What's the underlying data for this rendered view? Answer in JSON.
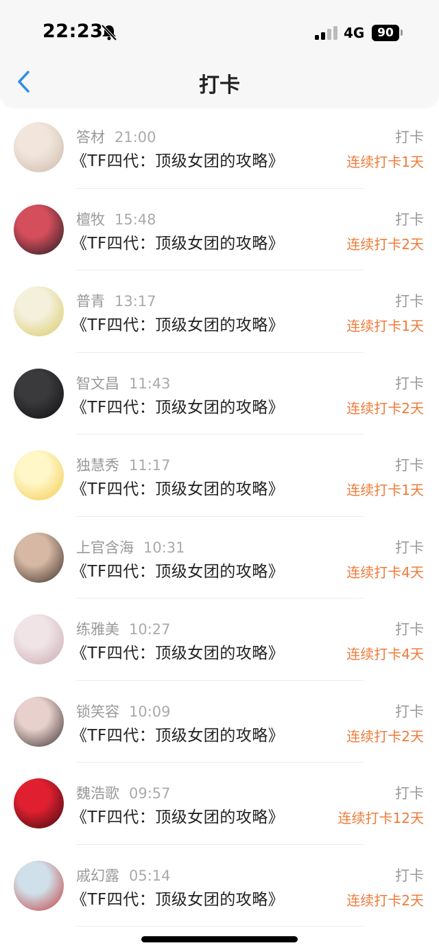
{
  "status_bar": {
    "time": "22:23",
    "network": "4G",
    "battery": "90"
  },
  "nav": {
    "title": "打卡"
  },
  "checkins": [
    {
      "name": "答材",
      "time": "21:00",
      "book": "《TF四代：顶级女团的攻略》",
      "action": "打卡",
      "streak": "连续打卡1天",
      "avatar_colors": [
        "#f2e6dc",
        "#c8b8a8"
      ]
    },
    {
      "name": "檀牧",
      "time": "15:48",
      "book": "《TF四代：顶级女团的攻略》",
      "action": "打卡",
      "streak": "连续打卡2天",
      "avatar_colors": [
        "#d44e5c",
        "#1c1a1e"
      ]
    },
    {
      "name": "普青",
      "time": "13:17",
      "book": "《TF四代：顶级女团的攻略》",
      "action": "打卡",
      "streak": "连续打卡1天",
      "avatar_colors": [
        "#f4f0dc",
        "#d8c860"
      ]
    },
    {
      "name": "智文昌",
      "time": "11:43",
      "book": "《TF四代：顶级女团的攻略》",
      "action": "打卡",
      "streak": "连续打卡2天",
      "avatar_colors": [
        "#3a3a3c",
        "#0e0e10"
      ]
    },
    {
      "name": "独慧秀",
      "time": "11:17",
      "book": "《TF四代：顶级女团的攻略》",
      "action": "打卡",
      "streak": "连续打卡1天",
      "avatar_colors": [
        "#fff7c8",
        "#f2c84a"
      ]
    },
    {
      "name": "上官含海",
      "time": "10:31",
      "book": "《TF四代：顶级女团的攻略》",
      "action": "打卡",
      "streak": "连续打卡4天",
      "avatar_colors": [
        "#d6b8a4",
        "#3a2c26"
      ]
    },
    {
      "name": "练雅美",
      "time": "10:27",
      "book": "《TF四代：顶级女团的攻略》",
      "action": "打卡",
      "streak": "连续打卡4天",
      "avatar_colors": [
        "#f0e4e6",
        "#c8a8b0"
      ]
    },
    {
      "name": "锁笑容",
      "time": "10:09",
      "book": "《TF四代：顶级女团的攻略》",
      "action": "打卡",
      "streak": "连续打卡2天",
      "avatar_colors": [
        "#e8d0cc",
        "#3a302e"
      ]
    },
    {
      "name": "魏浩歌",
      "time": "09:57",
      "book": "《TF四代：顶级女团的攻略》",
      "action": "打卡",
      "streak": "连续打卡12天",
      "avatar_colors": [
        "#e02030",
        "#3a0a0e"
      ]
    },
    {
      "name": "戚幻露",
      "time": "05:14",
      "book": "《TF四代：顶级女团的攻略》",
      "action": "打卡",
      "streak": "连续打卡2天",
      "avatar_colors": [
        "#cfe0ea",
        "#c43a3a"
      ]
    }
  ],
  "colors": {
    "accent": "#f07a38",
    "back_arrow": "#2f8ee8",
    "meta_text": "#999999"
  },
  "icons": {
    "back": "chevron-left-icon",
    "mute": "bell-slash-icon",
    "signal": "signal-icon",
    "battery": "battery-icon"
  }
}
